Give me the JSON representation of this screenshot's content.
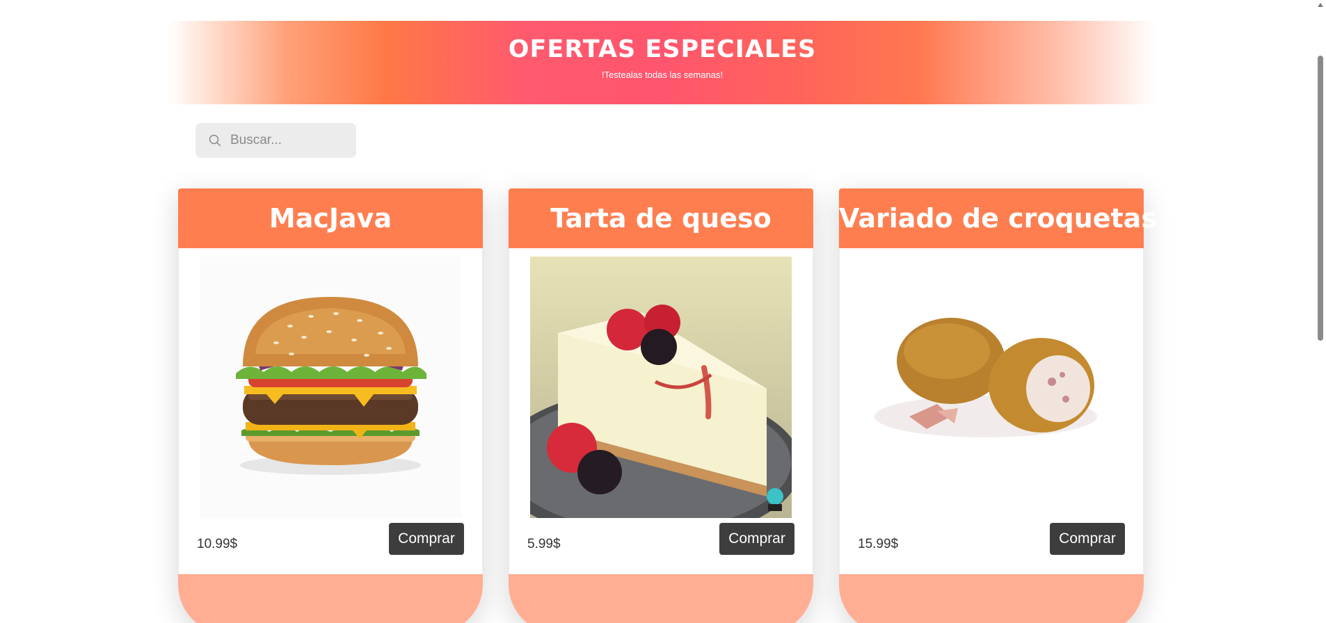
{
  "banner": {
    "title": "OFERTAS ESPECIALES",
    "subtitle": "!Testealas todas las semanas!"
  },
  "search": {
    "placeholder": "Buscar...",
    "value": ""
  },
  "products": [
    {
      "title": "MacJava",
      "price": "10.99$",
      "buy_label": "Comprar",
      "image": "burger"
    },
    {
      "title": "Tarta de queso",
      "price": "5.99$",
      "buy_label": "Comprar",
      "image": "cheesecake"
    },
    {
      "title": "Variado de croquetas",
      "price": "15.99$",
      "buy_label": "Comprar",
      "image": "croquettes"
    }
  ],
  "colors": {
    "card_header": "#ff7e50",
    "card_footer": "#ffae93",
    "button": "#3d3d3d",
    "banner_center": "#ff5a6e"
  }
}
